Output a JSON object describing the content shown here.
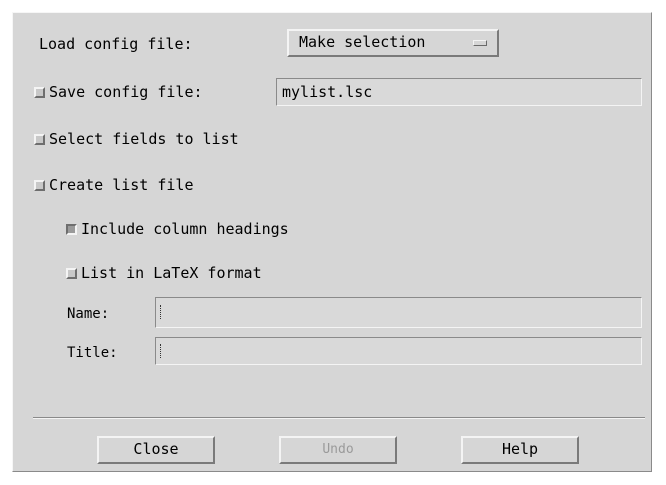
{
  "dialog": {
    "load_config_label": "Load config file:",
    "load_config_menu_value": "Make selection",
    "save_config_label": "Save config file:",
    "save_config_value": "mylist.lsc",
    "select_fields_label": "Select fields to list",
    "create_list_label": "Create list file",
    "include_headings_label": "Include column headings",
    "latex_format_label": "List in LaTeX format",
    "name_label": "Name:",
    "name_value": "",
    "title_label": "Title:",
    "title_value": ""
  },
  "buttons": {
    "close": "Close",
    "undo": "Undo",
    "help": "Help"
  }
}
